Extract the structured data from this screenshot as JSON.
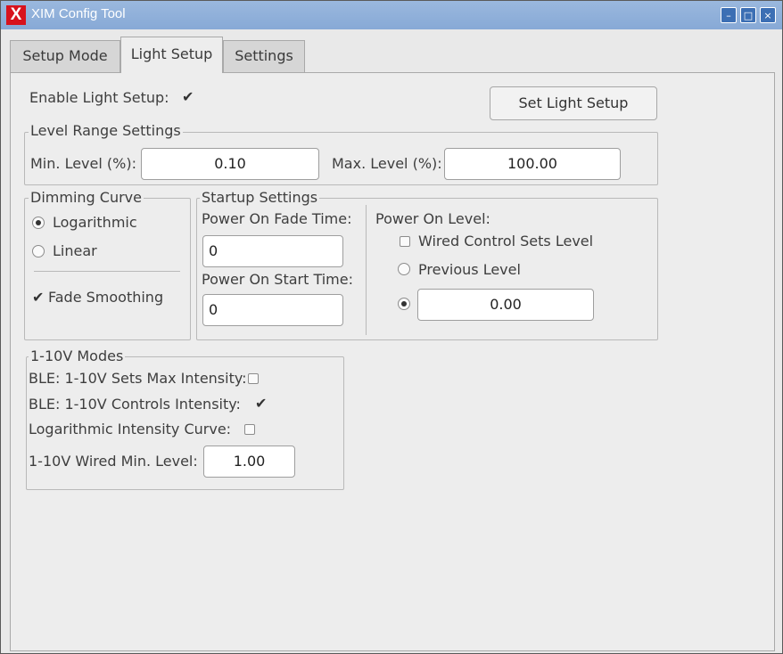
{
  "window": {
    "title": "XIM Config Tool",
    "logo": "X"
  },
  "titlebar_buttons": {
    "minimize": "–",
    "maximize": "□",
    "close": "×"
  },
  "tabs": [
    {
      "label": "Setup Mode"
    },
    {
      "label": "Light Setup"
    },
    {
      "label": "Settings"
    }
  ],
  "active_tab": "Light Setup",
  "top": {
    "enable_label": "Enable Light Setup:",
    "enable_checked": true,
    "set_button": "Set Light Setup"
  },
  "level_range": {
    "title": "Level Range Settings",
    "min_label": "Min. Level (%):",
    "min_value": "0.10",
    "max_label": "Max. Level (%):",
    "max_value": "100.00"
  },
  "dimming": {
    "title": "Dimming Curve",
    "logarithmic": "Logarithmic",
    "linear": "Linear",
    "selected": "Logarithmic",
    "fade_smoothing": "Fade Smoothing",
    "fade_smoothing_checked": true
  },
  "startup": {
    "title": "Startup Settings",
    "fade_time_label": "Power On Fade Time:",
    "fade_time_value": "0",
    "start_time_label": "Power On Start Time:",
    "start_time_value": "0",
    "power_on_level_label": "Power On Level:",
    "wired_label": "Wired Control Sets Level",
    "wired_checked": false,
    "previous_label": "Previous Level",
    "custom_value": "0.00",
    "selected": "custom"
  },
  "modes": {
    "title": "1-10V Modes",
    "ble_max_label": "BLE: 1-10V Sets Max Intensity:",
    "ble_max_checked": false,
    "ble_controls_label": "BLE: 1-10V Controls Intensity:",
    "ble_controls_checked": true,
    "log_curve_label": "Logarithmic Intensity Curve:",
    "log_curve_checked": false,
    "wired_min_label": "1-10V Wired Min. Level:",
    "wired_min_value": "1.00"
  },
  "check_glyph": "✔",
  "colors": {
    "titlebar": "#87a9d6",
    "logo": "#d7121d",
    "panel": "#ededed"
  }
}
